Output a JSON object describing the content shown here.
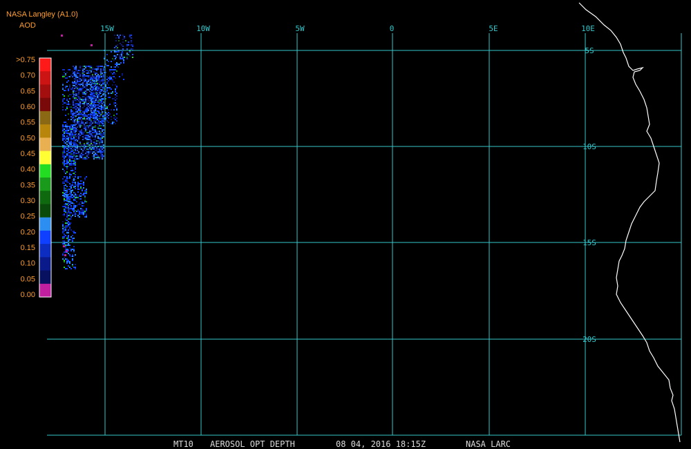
{
  "header": {
    "source": "NASA Langley (A1.0)",
    "variable": "AOD"
  },
  "colors": {
    "grid": "#33c8cc",
    "coast": "#ffffff",
    "text_cyan": "#33c8cc",
    "legend_text": "#ff9e2c",
    "footer": "#dcdcdc"
  },
  "legend": {
    "labels": [
      ">0.75",
      "0.70",
      "0.65",
      "0.60",
      "0.55",
      "0.50",
      "0.45",
      "0.40",
      "0.35",
      "0.30",
      "0.25",
      "0.20",
      "0.15",
      "0.10",
      "0.05",
      "0.00"
    ],
    "colors": [
      "#ff1a1a",
      "#cc1414",
      "#a30f0f",
      "#7a0a0a",
      "#8b6914",
      "#b8860b",
      "#e8b050",
      "#ffff33",
      "#22dd22",
      "#1a9a1a",
      "#0f6a0f",
      "#0a4a0a",
      "#2b8ef0",
      "#1040ff",
      "#0c2dc0",
      "#0a1a8a",
      "#081060",
      "#c020a0"
    ]
  },
  "grid": {
    "lon_labels": [
      "15W",
      "10W",
      "5W",
      "0",
      "5E",
      "10E"
    ],
    "lat_labels": [
      "5S",
      "10S",
      "15S",
      "20S"
    ]
  },
  "footer": {
    "product": "MT10",
    "title": "AEROSOL OPT DEPTH",
    "datetime": "08 04, 2016 18:15Z",
    "org": "NASA LARC"
  }
}
